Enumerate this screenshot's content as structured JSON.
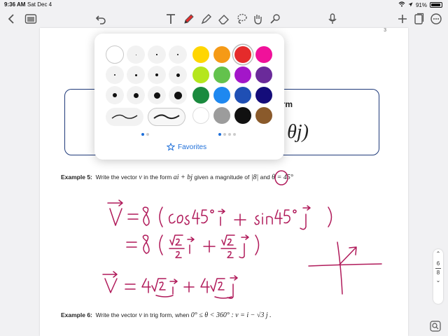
{
  "status_bar": {
    "time": "9:36 AM",
    "date": "Sat Dec 4",
    "battery": "91%",
    "battery_level": 0.91
  },
  "toolbar": {
    "icons": [
      "chevron-left-icon",
      "sidebar-icon",
      "undo-icon",
      "text-tool-icon",
      "pen-icon",
      "highlighter-icon",
      "eraser-icon",
      "lasso-icon",
      "hand-tool-icon",
      "laser-pointer-icon",
      "microphone-icon",
      "add-page-icon",
      "pages-icon",
      "more-icon"
    ],
    "active_tool": "pen",
    "active_color": "#e52b2b"
  },
  "page": {
    "corner_number": "3",
    "definition_box": {
      "heading": "rm",
      "formula_fragment": "θj)"
    },
    "example5": {
      "label": "Example 5:",
      "text1": "Write the vector",
      "v": "v",
      "text2": "in the form",
      "form": "ai + bj",
      "text3": "given a magnitude of",
      "magnitude": "|8|",
      "text4": "and",
      "angle": "θ = 45°"
    },
    "example6": {
      "label": "Example 6:",
      "text1": "Write the vector",
      "v": "v",
      "text2": "in trig form, when",
      "condition": "0° ≤ θ < 360° :",
      "equation": "v = i − √3 j ."
    },
    "handwriting_color": "#b01a5a"
  },
  "popover": {
    "sizes_pager": 2,
    "colors": [
      "#ffd600",
      "#f59a16",
      "#e52b2b",
      "#f0119a",
      "#b5e61d",
      "#63c24d",
      "#a316c9",
      "#6a2a9a",
      "#1a8a3e",
      "#1e88f0",
      "#1f4fb4",
      "#140c7a",
      "#ffffff",
      "#9c9c9c",
      "#111111",
      "#8a5a2b"
    ],
    "selected_color": "#e52b2b",
    "favorites_label": "Favorites"
  },
  "page_indicator": {
    "current": "6",
    "total": "8"
  }
}
